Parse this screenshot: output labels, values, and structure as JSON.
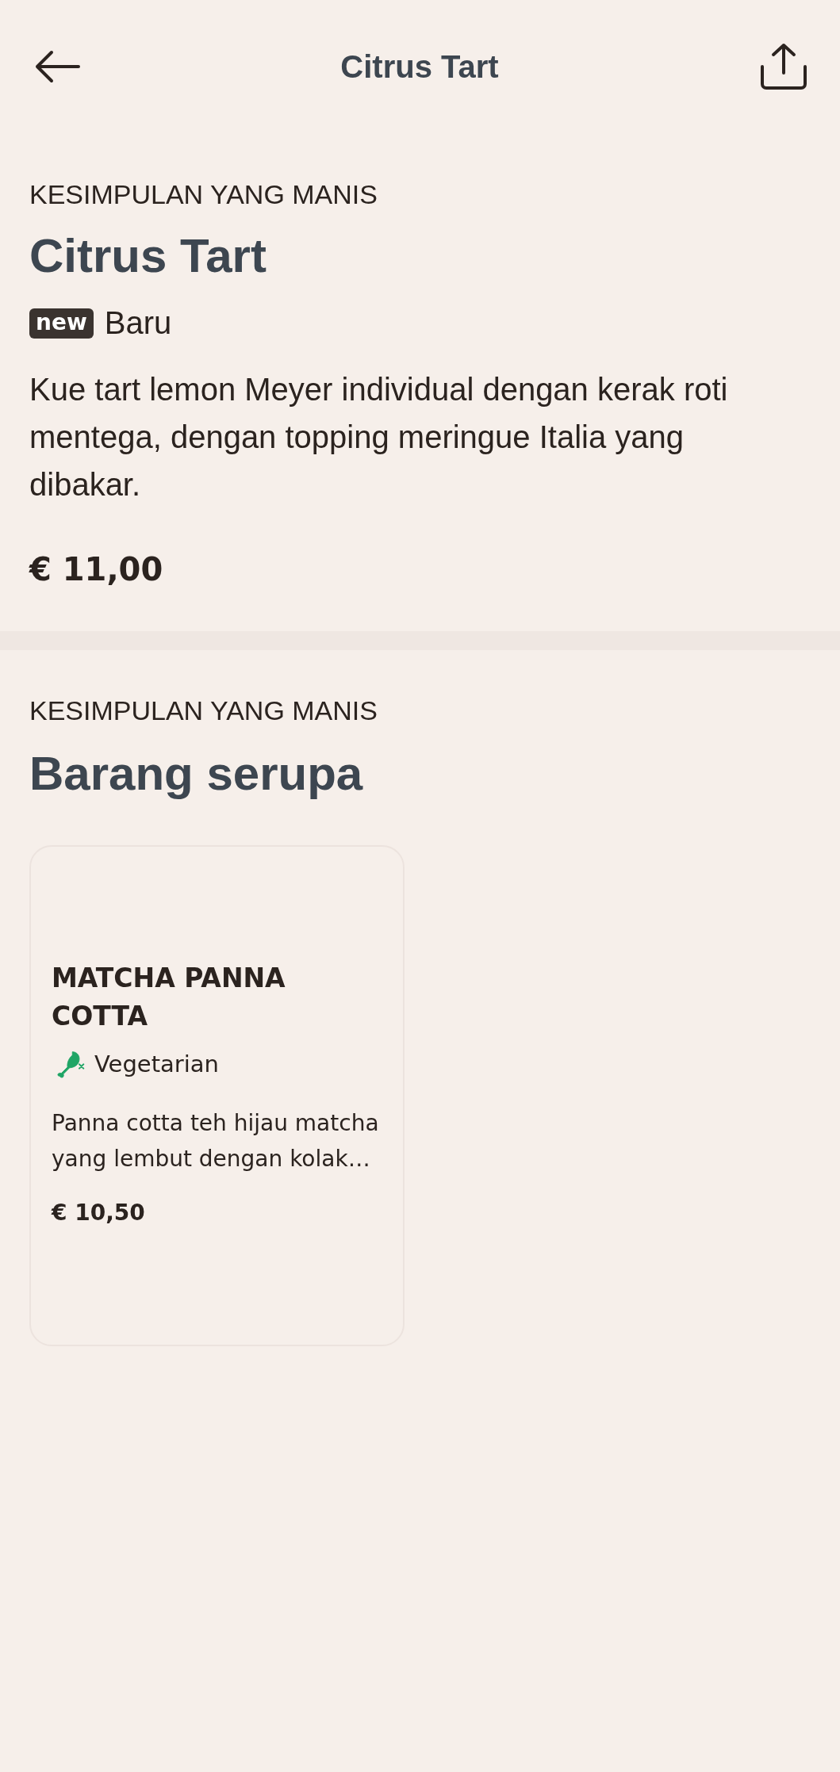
{
  "header": {
    "title": "Citrus Tart"
  },
  "product": {
    "category": "KESIMPULAN YANG MANIS",
    "name": "Citrus Tart",
    "badge": {
      "label": "new",
      "text": "Baru"
    },
    "description": "Kue tart lemon Meyer individual dengan kerak roti mentega, dengan topping meringue Italia yang dibakar.",
    "price": "€ 11,00"
  },
  "similar": {
    "category": "KESIMPULAN YANG MANIS",
    "heading": "Barang serupa",
    "items": [
      {
        "name": "MATCHA PANNA COTTA",
        "diet": {
          "kind": "vegetarian",
          "label": "Vegetarian",
          "color": "#1fa565"
        },
        "description": "Panna cotta teh hijau matcha yang lembut dengan kolak…",
        "price": "€ 10,50"
      }
    ]
  }
}
